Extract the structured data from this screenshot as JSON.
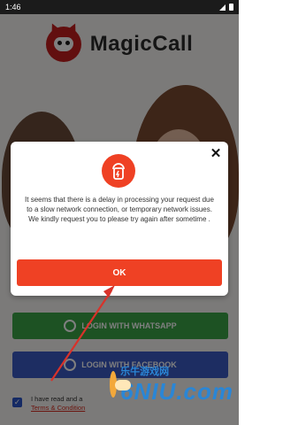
{
  "status_bar": {
    "time": "1:46"
  },
  "app": {
    "title": "MagicCall",
    "whatsapp_button": "LOGIN WITH WHATSAPP",
    "facebook_button": "LOGIN WITH FACEBOOK",
    "terms": {
      "prefix": "I have read and a",
      "link": "Terms & Condition"
    }
  },
  "dialog": {
    "message": "It seems that there is a delay in processing your request due to a slow network connection, or temporary network issues. We kindly request you to please try again after sometime .",
    "ok_label": "OK"
  },
  "watermark": {
    "logo_text": "6NIU.com",
    "sub_text": "乐牛游戏网"
  },
  "colors": {
    "accent": "#ef4124",
    "whatsapp": "#3aa447",
    "facebook": "#3b5bc4",
    "overlay": "rgba(0,0,0,0.5)"
  }
}
